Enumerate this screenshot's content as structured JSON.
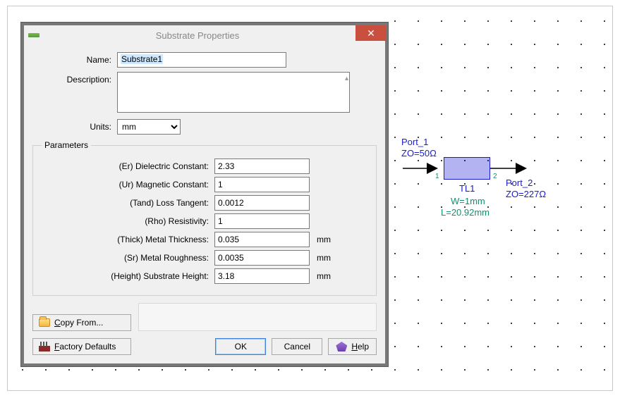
{
  "dialog": {
    "title": "Substrate Properties",
    "labels": {
      "name": "Name:",
      "description": "Description:",
      "units": "Units:"
    },
    "name_value": "Substrate1",
    "units_value": "mm",
    "params_legend": "Parameters",
    "params": [
      {
        "label": "(Er) Dielectric Constant:",
        "value": "2.33",
        "unit": ""
      },
      {
        "label": "(Ur) Magnetic Constant:",
        "value": "1",
        "unit": ""
      },
      {
        "label": "(Tand) Loss Tangent:",
        "value": "0.0012",
        "unit": ""
      },
      {
        "label": "(Rho) Resistivity:",
        "value": "1",
        "unit": ""
      },
      {
        "label": "(Thick) Metal Thickness:",
        "value": "0.035",
        "unit": "mm"
      },
      {
        "label": "(Sr) Metal Roughness:",
        "value": "0.0035",
        "unit": "mm"
      },
      {
        "label": "(Height) Substrate Height:",
        "value": "3.18",
        "unit": "mm"
      }
    ],
    "buttons": {
      "copy_from": "Copy From...",
      "factory": "Factory Defaults",
      "ok": "OK",
      "cancel": "Cancel",
      "help": "Help"
    }
  },
  "schematic": {
    "port1": "Port_1",
    "port1_zo": "ZO=50Ω",
    "port2": "Port_2",
    "port2_zo": "ZO=227Ω",
    "tl_name": "TL1",
    "w": "W=1mm",
    "l": "L=20.92mm",
    "pin1": "1",
    "pin2": "2"
  }
}
